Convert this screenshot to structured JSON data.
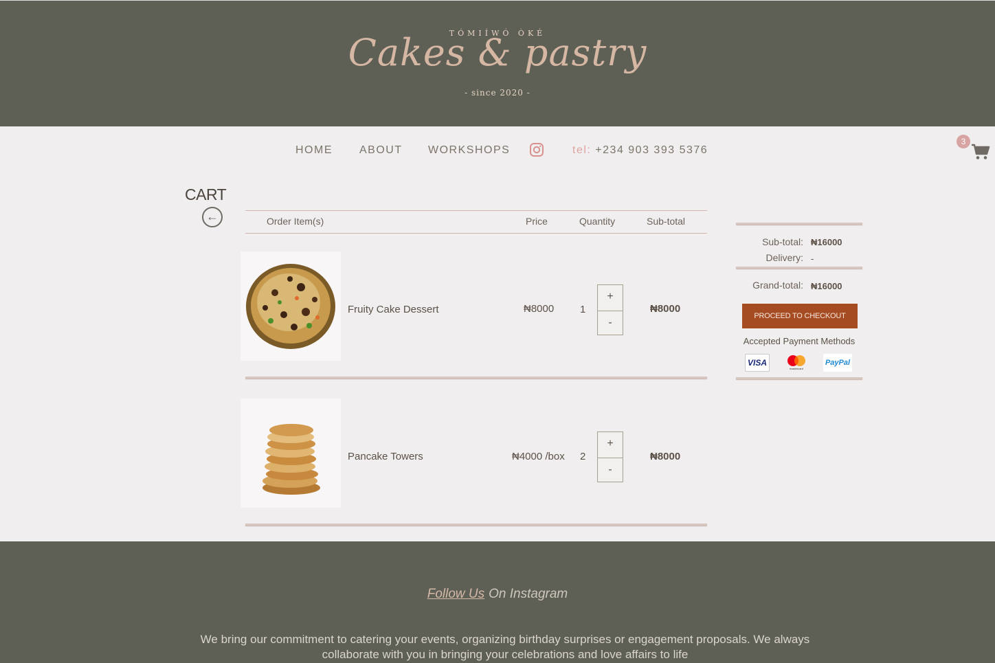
{
  "header": {
    "brand_top": "TÓMIÍWÓ ÒKÉ",
    "brand_main": "Cakes & pastry",
    "since": "- since 2020 -"
  },
  "nav": {
    "items": [
      "HOME",
      "ABOUT",
      "WORKSHOPS"
    ],
    "instagram_icon": "instagram-icon",
    "tel_label": "tel:",
    "tel_number": "+234 903 393 5376",
    "cart_count": "3",
    "cart_icon": "cart-icon",
    "accent_color": "#d8a3a3"
  },
  "cart": {
    "title": "CART",
    "back_icon": "left-arrow-circle-icon",
    "columns": [
      "Order Item(s)",
      "Price",
      "Quantity",
      "Sub-total"
    ],
    "items": [
      {
        "name": "Fruity Cake Dessert",
        "price": "₦8000",
        "qty": "1",
        "plus": "+",
        "minus": "-",
        "subtotal": "₦8000",
        "image": "fruity-cake-image"
      },
      {
        "name": "Pancake Towers",
        "price": "₦4000 /box",
        "qty": "2",
        "plus": "+",
        "minus": "-",
        "subtotal": "₦8000",
        "image": "pancake-image"
      }
    ]
  },
  "summary": {
    "subtotal_label": "Sub-total:",
    "subtotal_value": "₦16000",
    "delivery_label": "Delivery:",
    "delivery_value": "-",
    "grand_label": "Grand-total:",
    "grand_value": "₦16000",
    "checkout_label": "PROCEED TO CHECKOUT",
    "checkout_color": "#a64c22",
    "payment_label": "Accepted Payment Methods",
    "payment_methods": [
      "VISA",
      "mastercard",
      "PayPal"
    ]
  },
  "footer": {
    "follow_link": "Follow Us",
    "follow_rest": "On Instagram",
    "text": "We bring our commitment to catering your events, organizing birthday surprises or engagement proposals. We always collaborate with you in bringing your celebrations and love affairs to life"
  }
}
